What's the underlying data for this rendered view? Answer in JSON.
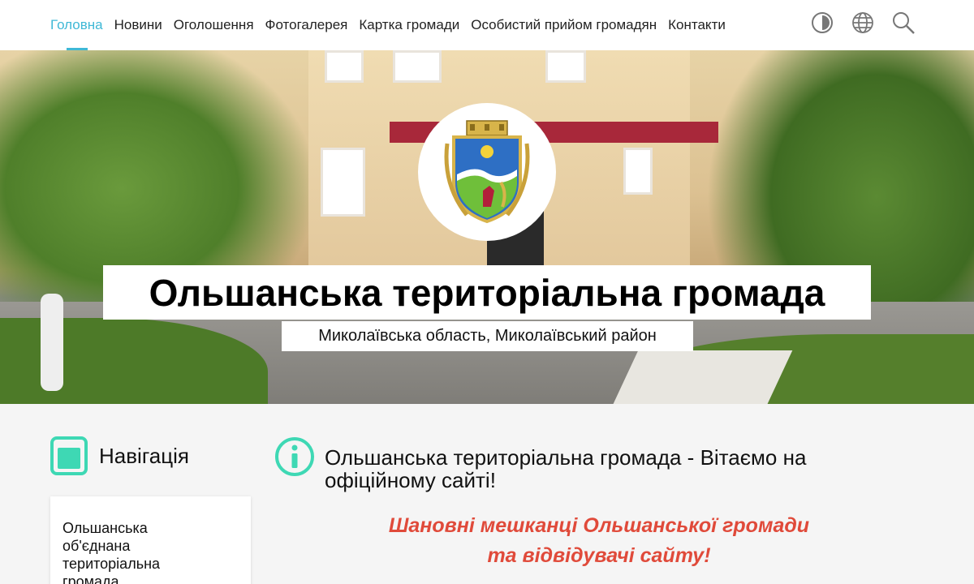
{
  "nav": {
    "items": [
      {
        "label": "Головна",
        "active": true
      },
      {
        "label": "Новини",
        "active": false
      },
      {
        "label": "Оголошення",
        "active": false
      },
      {
        "label": "Фотогалерея",
        "active": false
      },
      {
        "label": "Картка громади",
        "active": false
      },
      {
        "label": "Особистий прийом громадян",
        "active": false
      },
      {
        "label": "Контакти",
        "active": false
      }
    ],
    "active_color": "#3fb8d6"
  },
  "tools": [
    "contrast-icon",
    "globe-icon",
    "search-icon"
  ],
  "hero": {
    "title": "Ольшанська територіальна громада",
    "subtitle": "Миколаївська область, Миколаївський район"
  },
  "sidebar": {
    "heading": "Навігація",
    "items": [
      "Ольшанська об'єднана територіальна громада"
    ]
  },
  "main": {
    "heading": "Ольшанська територіальна громада - Вітаємо на офіційному сайті!",
    "greeting_line1": "Шановні мешканці Ольшанської громади",
    "greeting_line2": "та відвідувачі сайту!"
  },
  "colors": {
    "accent": "#3fb8d6",
    "icon_teal": "#3ed8b4",
    "greeting_red": "#e04a3a"
  }
}
